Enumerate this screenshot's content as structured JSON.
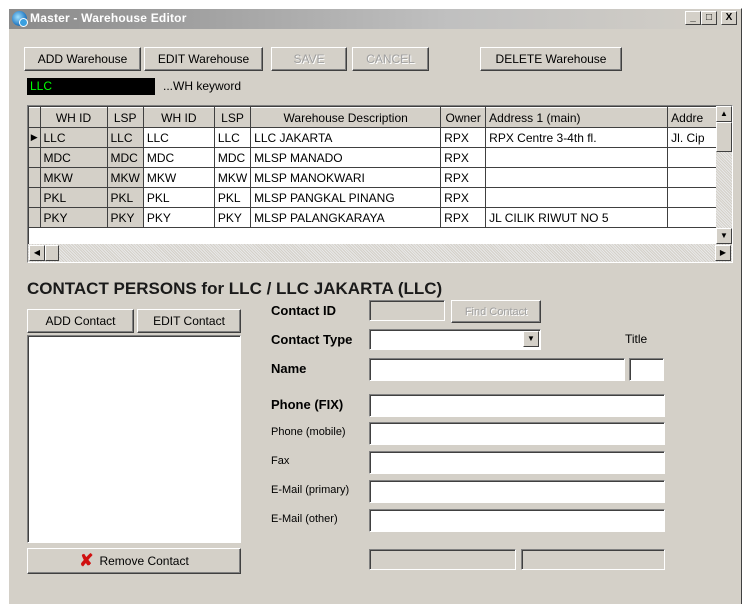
{
  "window": {
    "title": "Master - Warehouse Editor",
    "min_glyph": "_",
    "max_glyph": "□",
    "close_glyph": "X"
  },
  "toolbar": {
    "add": "ADD Warehouse",
    "edit": "EDIT Warehouse",
    "save": "SAVE",
    "cancel": "CANCEL",
    "delete": "DELETE Warehouse"
  },
  "search": {
    "value": "LLC",
    "label": "...WH keyword"
  },
  "grid": {
    "headers": [
      "WH ID",
      "LSP",
      "WH ID",
      "LSP",
      "Warehouse Description",
      "Owner",
      "Address 1 (main)",
      "Addre"
    ],
    "rows": [
      [
        "LLC",
        "LLC",
        "LLC",
        "LLC",
        "LLC JAKARTA",
        "RPX",
        "RPX Centre 3-4th fl.",
        "Jl. Cip"
      ],
      [
        "MDC",
        "MDC",
        "MDC",
        "MDC",
        "MLSP MANADO",
        "RPX",
        "",
        ""
      ],
      [
        "MKW",
        "MKW",
        "MKW",
        "MKW",
        "MLSP MANOKWARI",
        "RPX",
        "",
        ""
      ],
      [
        "PKL",
        "PKL",
        "PKL",
        "PKL",
        "MLSP PANGKAL PINANG",
        "RPX",
        "",
        ""
      ],
      [
        "PKY",
        "PKY",
        "PKY",
        "PKY",
        "MLSP PALANGKARAYA",
        "RPX",
        "JL CILIK RIWUT NO 5",
        ""
      ]
    ],
    "current_row_glyph": "▶",
    "scroll_up_glyph": "▲",
    "scroll_down_glyph": "▼",
    "scroll_left_glyph": "◀",
    "scroll_right_glyph": "▶"
  },
  "contacts": {
    "title": "CONTACT PERSONS for LLC / LLC JAKARTA (LLC)",
    "add": "ADD Contact",
    "edit": "EDIT Contact",
    "remove": "Remove Contact",
    "remove_glyph": "✘"
  },
  "form": {
    "contact_id_label": "Contact ID",
    "find_contact": "Find Contact",
    "contact_type_label": "Contact Type",
    "dropdown_glyph": "▼",
    "title_label": "Title",
    "name_label": "Name",
    "phone_fix_label": "Phone (FIX)",
    "phone_mobile_label": "Phone (mobile)",
    "fax_label": "Fax",
    "email_primary_label": "E-Mail (primary)",
    "email_other_label": "E-Mail (other)"
  }
}
